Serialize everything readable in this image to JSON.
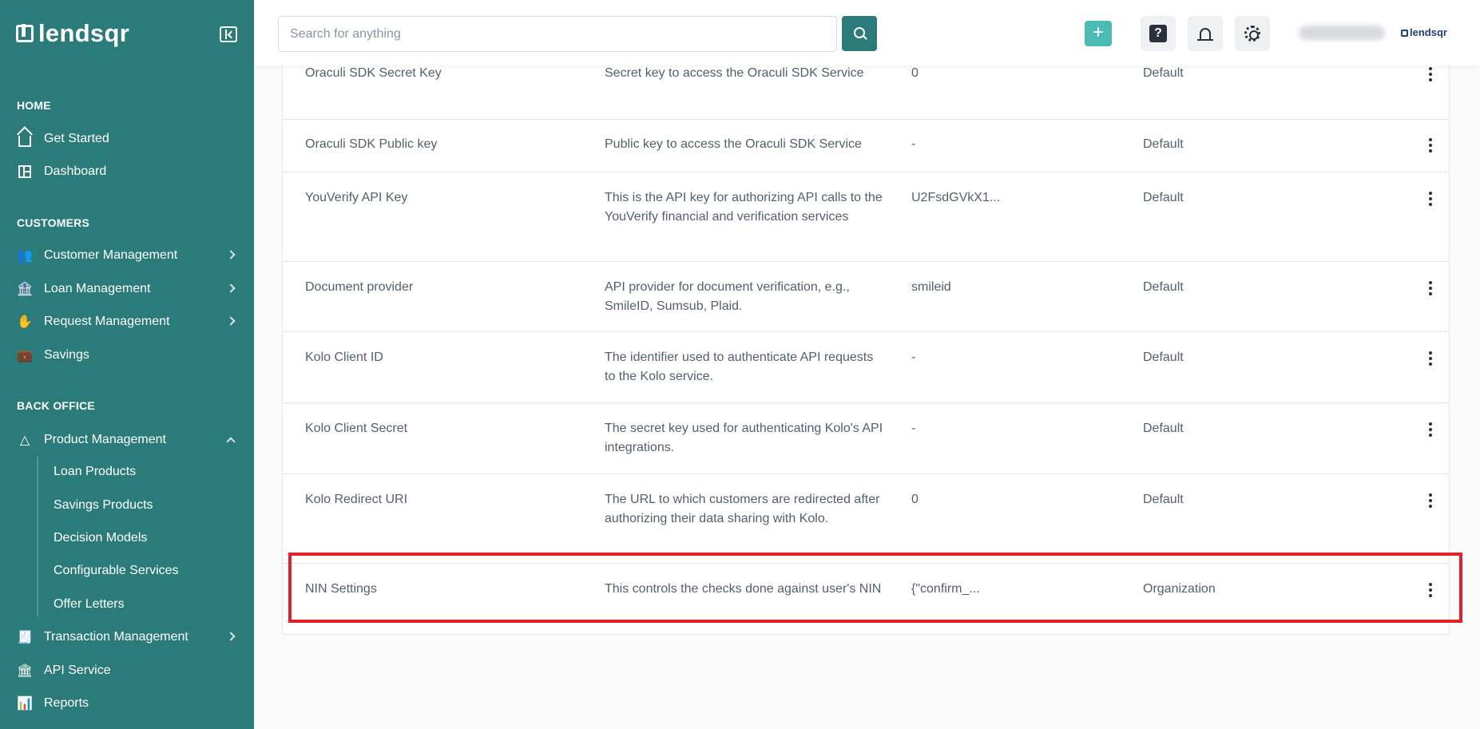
{
  "brand": {
    "logo_text": "lendsqr",
    "small_logo_text": "lendsqr"
  },
  "search": {
    "placeholder": "Search for anything"
  },
  "topbar": {
    "add_label": "+",
    "help_label": "?"
  },
  "colors": {
    "sidebar": "#2b7b7a",
    "accent": "#4bbcb4",
    "highlight": "#e2202a"
  },
  "sidebar": {
    "sections": [
      {
        "label": "HOME",
        "items": [
          {
            "label": "Get Started",
            "icon": "home-icon"
          },
          {
            "label": "Dashboard",
            "icon": "dashboard-icon"
          }
        ]
      },
      {
        "label": "CUSTOMERS",
        "items": [
          {
            "label": "Customer Management",
            "icon": "users-icon",
            "expandable": true
          },
          {
            "label": "Loan Management",
            "icon": "bank-icon",
            "expandable": true
          },
          {
            "label": "Request Management",
            "icon": "hand-money-icon",
            "expandable": true
          },
          {
            "label": "Savings",
            "icon": "briefcase-icon"
          }
        ]
      },
      {
        "label": "BACK OFFICE",
        "items": [
          {
            "label": "Product Management",
            "icon": "shapes-icon",
            "expanded": true,
            "children": [
              "Loan Products",
              "Savings Products",
              "Decision Models",
              "Configurable Services",
              "Offer Letters"
            ]
          },
          {
            "label": "Transaction Management",
            "icon": "receipt-icon",
            "expandable": true
          },
          {
            "label": "API Service",
            "icon": "institution-icon"
          },
          {
            "label": "Reports",
            "icon": "chart-icon"
          }
        ]
      }
    ]
  },
  "table": {
    "rows": [
      {
        "name": "Oraculi SDK Secret Key",
        "description": "Secret key to access the Oraculi SDK Service",
        "value": "0",
        "scope": "Default"
      },
      {
        "name": "Oraculi SDK Public key",
        "description": "Public key to access the Oraculi SDK Service",
        "value": "-",
        "scope": "Default"
      },
      {
        "name": "YouVerify API Key",
        "description": "This is the API key for authorizing API calls to the YouVerify financial and verification services",
        "value": "U2FsdGVkX1...",
        "scope": "Default"
      },
      {
        "name": "Document provider",
        "description": "API provider for document verification, e.g., SmileID, Sumsub, Plaid.",
        "value": "smileid",
        "scope": "Default"
      },
      {
        "name": "Kolo Client ID",
        "description": "The identifier used to authenticate API requests to the Kolo service.",
        "value": "-",
        "scope": "Default"
      },
      {
        "name": "Kolo Client Secret",
        "description": "The secret key used for authenticating Kolo's API integrations.",
        "value": "-",
        "scope": "Default"
      },
      {
        "name": "Kolo Redirect URI",
        "description": "The URL to which customers are redirected after authorizing their data sharing with Kolo.",
        "value": "0",
        "scope": "Default"
      },
      {
        "name": "NIN Settings",
        "description": "This controls the checks done against user's NIN",
        "value": "{\"confirm_...",
        "scope": "Organization"
      }
    ]
  }
}
